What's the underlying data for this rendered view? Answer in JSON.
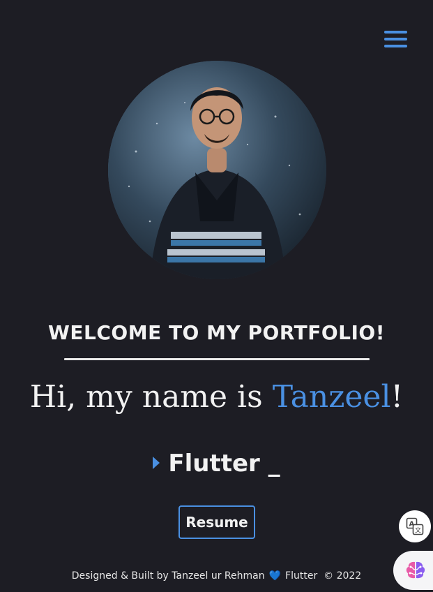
{
  "header": {
    "menu_icon": "hamburger-menu-icon"
  },
  "hero": {
    "avatar_alt": "profile-photo",
    "welcome": "WELCOME TO MY PORTFOLIO!",
    "intro_prefix": "Hi, my name is ",
    "intro_name": "Tanzeel",
    "intro_suffix": "!",
    "role_text": "Flutter _",
    "accent_color": "#4a90e2"
  },
  "actions": {
    "resume_label": "Resume"
  },
  "footer": {
    "credit": "Designed & Built by Tanzeel ur Rehman",
    "heart": "💙",
    "framework": "Flutter",
    "copyright": "© 2022"
  },
  "widgets": {
    "translate_icon": "translate-icon",
    "brain_icon": "brain-icon"
  }
}
